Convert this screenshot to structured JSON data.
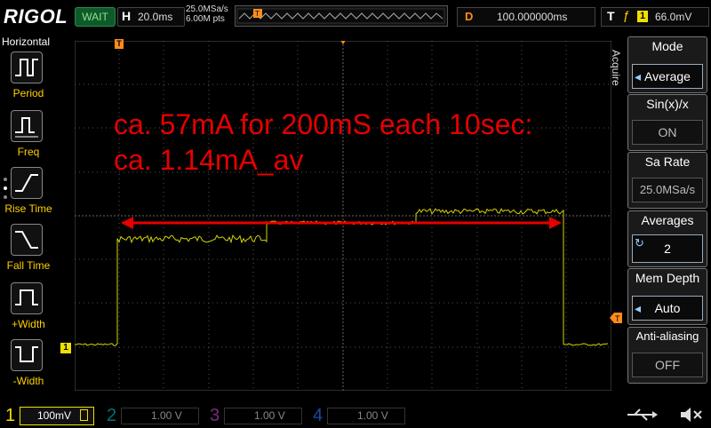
{
  "topbar": {
    "logo": "RIGOL",
    "run_status": "WAIT",
    "horizontal_label": "H",
    "timebase": "20.0ms",
    "sample_rate": "25.0MSa/s",
    "memory_points": "6.00M pts",
    "delay_label": "D",
    "delay_value": "100.000000ms",
    "trigger_label": "T",
    "trigger_channel": "1",
    "trigger_level": "66.0mV"
  },
  "left_panel": {
    "title": "Horizontal",
    "items": [
      {
        "label": "Period",
        "icon": "period-icon"
      },
      {
        "label": "Freq",
        "icon": "freq-icon"
      },
      {
        "label": "Rise Time",
        "icon": "rise-time-icon"
      },
      {
        "label": "Fall Time",
        "icon": "fall-time-icon"
      },
      {
        "label": "+Width",
        "icon": "pos-width-icon"
      },
      {
        "label": "-Width",
        "icon": "neg-width-icon"
      }
    ]
  },
  "screen": {
    "annotation_line1": "ca. 57mA for 200mS each 10sec:",
    "annotation_line2": "ca. 1.14mA_av",
    "trigger_marker": "T",
    "channel_marker": "1",
    "trace_color": "#d4d400",
    "annotation_color": "#e60000"
  },
  "right_panel": {
    "section": "Acquire",
    "items": [
      {
        "title": "Mode",
        "value": "Average"
      },
      {
        "title": "Sin(x)/x",
        "value": "ON"
      },
      {
        "title": "Sa Rate",
        "value": "25.0MSa/s"
      },
      {
        "title": "Averages",
        "value": "2"
      },
      {
        "title": "Mem Depth",
        "value": "Auto"
      },
      {
        "title": "Anti-aliasing",
        "value": "OFF"
      }
    ]
  },
  "bottombar": {
    "channels": [
      {
        "num": "1",
        "scale": "100mV",
        "color": "#f0e000"
      },
      {
        "num": "2",
        "scale": "1.00 V",
        "color": "#00c8e0"
      },
      {
        "num": "3",
        "scale": "1.00 V",
        "color": "#e040e0"
      },
      {
        "num": "4",
        "scale": "1.00 V",
        "color": "#2a7fff"
      }
    ]
  }
}
